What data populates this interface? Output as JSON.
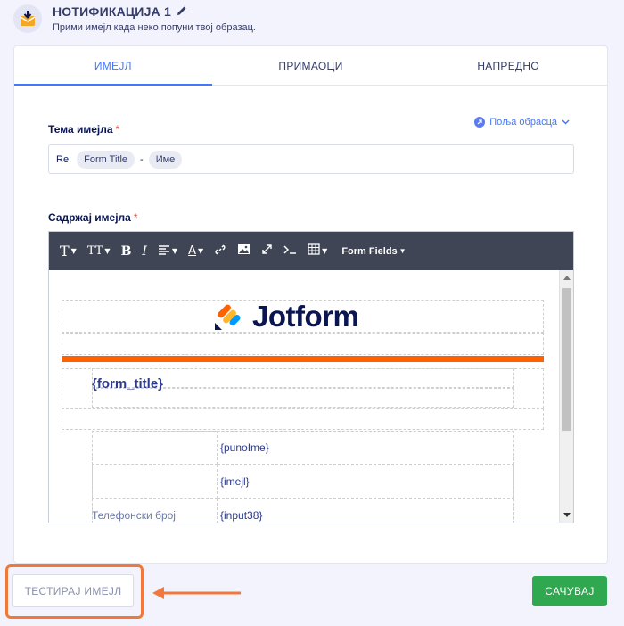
{
  "header": {
    "title": "НОТИФИКАЦИЈА 1",
    "subtitle": "Прими имејл када неко попуни твој образац.",
    "icon": "envelope-download-icon",
    "edit_icon": "pencil-icon"
  },
  "tabs": [
    {
      "label": "ИМЕЈЛ",
      "active": true
    },
    {
      "label": "ПРИМАОЦИ",
      "active": false
    },
    {
      "label": "НАПРЕДНО",
      "active": false
    }
  ],
  "subject": {
    "label": "Тема имејла",
    "required_mark": "*",
    "prefix": "Re:",
    "tag1": "Form Title",
    "separator": "-",
    "tag2": "Име"
  },
  "form_fields_link": "Поља обрасца",
  "content": {
    "label": "Садржај имејла",
    "required_mark": "*"
  },
  "toolbar": {
    "font": "T",
    "size": "TT",
    "bold": "B",
    "italic": "I",
    "form_fields": "Form Fields"
  },
  "email_body": {
    "logo_text": "Jotform",
    "form_title": "{form_title}",
    "rows": [
      {
        "label": "",
        "value": "{punoIme}"
      },
      {
        "label": "",
        "value": "{imejl}"
      },
      {
        "label": "Телефонски број",
        "value": "{input38}"
      }
    ]
  },
  "buttons": {
    "test": "ТЕСТИРАЈ ИМЕЈЛ",
    "save": "САЧУВАЈ"
  },
  "colors": {
    "accent": "#4277ff",
    "save": "#2fa84f",
    "highlight": "#f0783c",
    "jotform_orange": "#ff6100",
    "toolbar": "#3f4554"
  }
}
